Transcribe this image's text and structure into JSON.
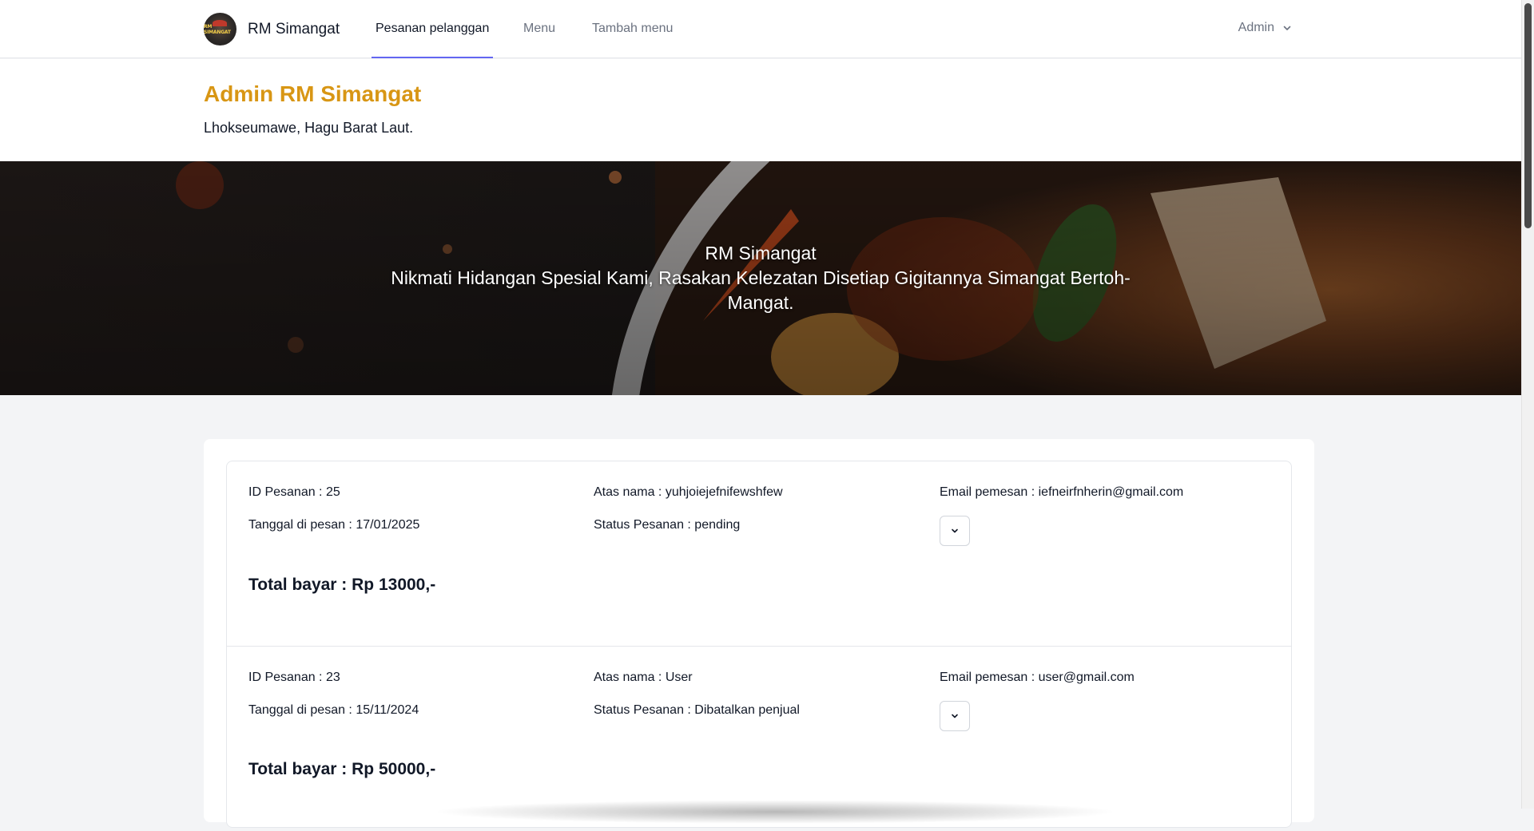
{
  "navbar": {
    "brand_name": "RM Simangat",
    "logo_text": "RM SIMANGAT",
    "nav_items": [
      {
        "label": "Pesanan pelanggan",
        "active": true
      },
      {
        "label": "Menu",
        "active": false
      },
      {
        "label": "Tambah menu",
        "active": false
      }
    ],
    "user_menu_label": "Admin"
  },
  "header": {
    "title": "Admin RM Simangat",
    "subtitle": "Lhokseumawe, Hagu Barat Laut."
  },
  "hero": {
    "title": "RM Simangat",
    "tagline": "Nikmati Hidangan Spesial Kami, Rasakan Kelezatan Disetiap Gigitannya Simangat Bertoh-Mangat."
  },
  "orders": [
    {
      "id_text": "ID Pesanan : 25",
      "date_text": "Tanggal di pesan : 17/01/2025",
      "name_text": "Atas nama : yuhjoiejefnifewshfew",
      "status_text": "Status Pesanan : pending",
      "email_text": "Email pemesan : iefneirfnherin@gmail.com",
      "total_text": "Total bayar : Rp 13000,-"
    },
    {
      "id_text": "ID Pesanan : 23",
      "date_text": "Tanggal di pesan : 15/11/2024",
      "name_text": "Atas nama : User",
      "status_text": "Status Pesanan : Dibatalkan penjual",
      "email_text": "Email pemesan : user@gmail.com",
      "total_text": "Total bayar : Rp 50000,-"
    }
  ],
  "colors": {
    "accent_title": "#d89614",
    "active_tab_underline": "#6366f1"
  },
  "icons": {
    "user_menu": "chevron-down-icon",
    "order_toggle": "chevron-down-icon"
  }
}
